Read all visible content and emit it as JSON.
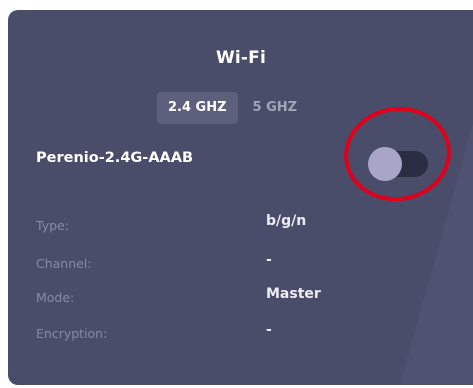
{
  "panel": {
    "title": "Wi-Fi",
    "tabs": [
      {
        "label": "2.4 GHZ",
        "active": true
      },
      {
        "label": "5 GHZ",
        "active": false
      }
    ],
    "network_name": "Perenio-2.4G-AAAB",
    "toggle": {
      "state": "off"
    },
    "details": [
      {
        "label": "Type:",
        "value": "b/g/n"
      },
      {
        "label": "Channel:",
        "value": "-"
      },
      {
        "label": "Mode:",
        "value": "Master"
      },
      {
        "label": "Encryption:",
        "value": "-"
      }
    ]
  },
  "colors": {
    "card_background": "#4a4d69",
    "tab_active_background": "#5d607c",
    "toggle_knob": "#a9a5c8",
    "toggle_track": "#2b2d42",
    "highlight_ring": "#e0001b"
  }
}
